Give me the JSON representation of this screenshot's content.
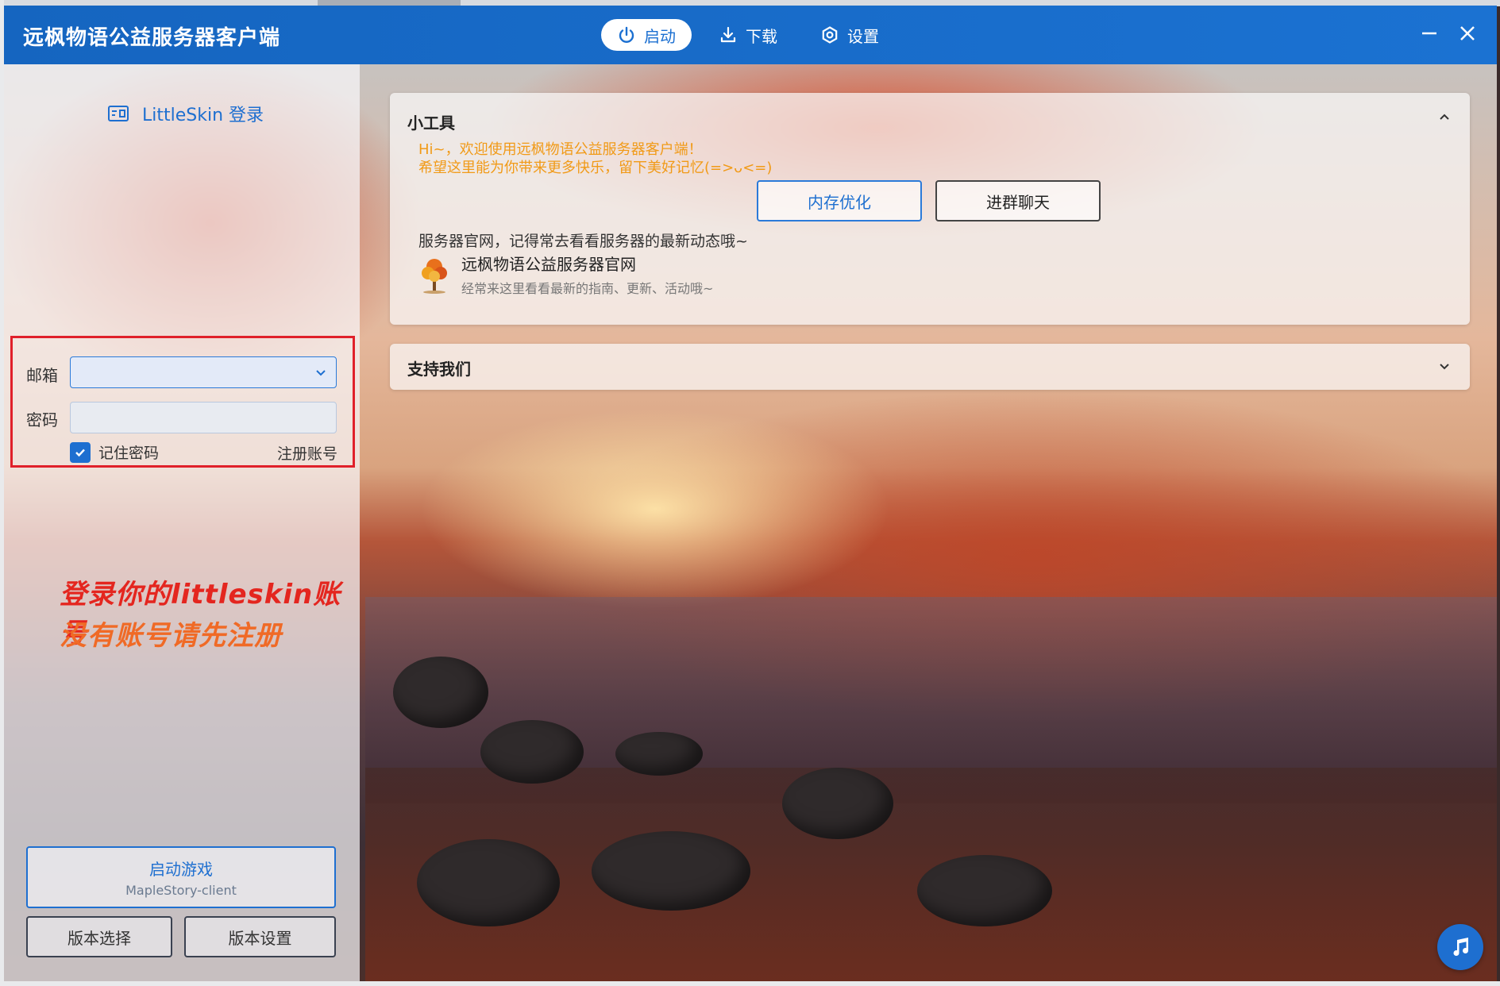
{
  "window": {
    "title": "远枫物语公益服务器客户端"
  },
  "nav": {
    "items": [
      {
        "label": "启动",
        "icon": "power-icon",
        "active": true
      },
      {
        "label": "下载",
        "icon": "download-icon",
        "active": false
      },
      {
        "label": "设置",
        "icon": "settings-icon",
        "active": false
      }
    ]
  },
  "sidebar": {
    "login_title": "LittleSkin 登录",
    "email_label": "邮箱",
    "email_value": "",
    "password_label": "密码",
    "password_value": "",
    "remember_label": "记住密码",
    "remember_checked": true,
    "register_label": "注册账号",
    "launch_label": "启动游戏",
    "launch_sub": "MapleStory-client",
    "version_select_label": "版本选择",
    "version_settings_label": "版本设置"
  },
  "annotation": {
    "line1": "登录你的littleskin账号",
    "line2": "没有账号请先注册",
    "color": "#e4261f"
  },
  "tools": {
    "title": "小工具",
    "welcome_line1": "Hi~，欢迎使用远枫物语公益服务器客户端！",
    "welcome_line2": "希望这里能为你带来更多快乐，留下美好记忆(=>ᴗ<=)",
    "memory_button": "内存优化",
    "chat_button": "进群聊天",
    "site_hint": "服务器官网，记得常去看看服务器的最新动态哦~",
    "site_title": "远枫物语公益服务器官网",
    "site_desc": "经常来这里看看最新的指南、更新、活动哦~"
  },
  "support": {
    "title": "支持我们"
  },
  "colors": {
    "accent": "#1e6fd0",
    "titlebar": "#1565c0",
    "welcome_text": "#f19a17",
    "highlight_box": "#e0202a"
  }
}
